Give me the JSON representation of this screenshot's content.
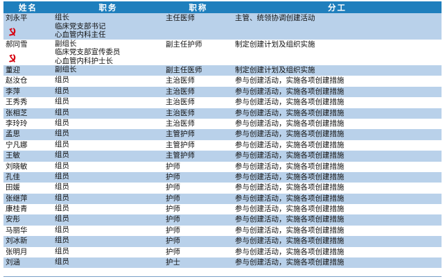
{
  "header": {
    "name": "姓名",
    "post": "职务",
    "title": "职称",
    "division": "分工"
  },
  "rows": [
    {
      "name": "刘永平",
      "roles": [
        "组长",
        "临床党支部书记",
        "心血管内科主任"
      ],
      "title": "主任医师",
      "duty": "主管、统领协调创建活动",
      "party": true
    },
    {
      "name": "郝同雪",
      "roles": [
        "副组长",
        "临床党支部宣传委员",
        "心血管内科护士长"
      ],
      "title": "副主任护师",
      "duty": "制定创建计划及组织实施",
      "party": true
    },
    {
      "name": "董迎",
      "roles": [
        "副组长"
      ],
      "title": "副主任医师",
      "duty": "制定创建计划及组织实施"
    },
    {
      "name": "赵汝仓",
      "roles": [
        "组员"
      ],
      "title": "主治医师",
      "duty": "参与创建活动，实施各项创建措施"
    },
    {
      "name": "李萍",
      "roles": [
        "组员"
      ],
      "title": "主治医师",
      "duty": "参与创建活动，实施各项创建措施"
    },
    {
      "name": "王秀秀",
      "roles": [
        "组员"
      ],
      "title": "主治医师",
      "duty": "参与创建活动，实施各项创建措施"
    },
    {
      "name": "张相芝",
      "roles": [
        "组员"
      ],
      "title": "主治医师",
      "duty": "参与创建活动，实施各项创建措施"
    },
    {
      "name": "李玲玲",
      "roles": [
        "组员"
      ],
      "title": "主治医师",
      "duty": "参与创建活动，实施各项创建措施"
    },
    {
      "name": "孟思",
      "roles": [
        "组员"
      ],
      "title": "主管护师",
      "duty": "参与创建活动，实施各项创建措施"
    },
    {
      "name": "宁凡娜",
      "roles": [
        "组员"
      ],
      "title": "主管护师",
      "duty": "参与创建活动，实施各项创建措施"
    },
    {
      "name": "王敏",
      "roles": [
        "组员"
      ],
      "title": "主管护师",
      "duty": "参与创建活动，实施各项创建措施"
    },
    {
      "name": "刘晓敏",
      "roles": [
        "组员"
      ],
      "title": "护师",
      "duty": "参与创建活动，实施各项创建措施"
    },
    {
      "name": "孔佳",
      "roles": [
        "组员"
      ],
      "title": "护师",
      "duty": "参与创建活动，实施各项创建措施"
    },
    {
      "name": "田媛",
      "roles": [
        "组员"
      ],
      "title": "护师",
      "duty": "参与创建活动，实施各项创建措施"
    },
    {
      "name": "张继萍",
      "roles": [
        "组员"
      ],
      "title": "护师",
      "duty": "参与创建活动，实施各项创建措施"
    },
    {
      "name": "康桂青",
      "roles": [
        "组员"
      ],
      "title": "护师",
      "duty": "参与创建活动，实施各项创建措施"
    },
    {
      "name": "安彤",
      "roles": [
        "组员"
      ],
      "title": "护师",
      "duty": "参与创建活动，实施各项创建措施"
    },
    {
      "name": "马丽华",
      "roles": [
        "组员"
      ],
      "title": "护师",
      "duty": "参与创建活动，实施各项创建措施"
    },
    {
      "name": "刘冰新",
      "roles": [
        "组员"
      ],
      "title": "护师",
      "duty": "参与创建活动，实施各项创建措施"
    },
    {
      "name": "张明月",
      "roles": [
        "组员"
      ],
      "title": "护师",
      "duty": "参与创建活动，实施各项创建措施"
    },
    {
      "name": "刘涵",
      "roles": [
        "组员"
      ],
      "title": "护士",
      "duty": "参与创建活动，实施各项创建措施"
    }
  ],
  "colors": {
    "header_bg": "#1f7fbd",
    "band_bg": "#b9d1ea",
    "party_red": "#d7000f"
  },
  "icons": {
    "party": "hammer-sickle-icon"
  }
}
